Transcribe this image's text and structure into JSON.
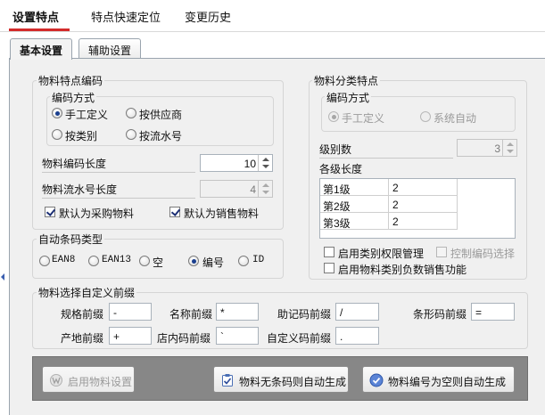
{
  "top_tabs": [
    "设置特点",
    "特点快速定位",
    "变更历史"
  ],
  "sub_tabs": [
    "基本设置",
    "辅助设置"
  ],
  "encode": {
    "title": "物料特点编码",
    "mode_title": "编码方式",
    "options": [
      "手工定义",
      "按供应商",
      "按类别",
      "按流水号"
    ],
    "selected": "手工定义",
    "code_length_label": "物料编码长度",
    "code_length_value": "10",
    "serial_length_label": "物料流水号长度",
    "serial_length_value": "4",
    "default_purchase_label": "默认为采购物料",
    "default_purchase_checked": true,
    "default_sales_label": "默认为销售物料",
    "default_sales_checked": true
  },
  "barcode": {
    "title": "自动条码类型",
    "options": [
      "EAN8",
      "EAN13",
      "空",
      "编号",
      "ID"
    ],
    "selected": "编号"
  },
  "category": {
    "title": "物料分类特点",
    "mode_title": "编码方式",
    "options": [
      "手工定义",
      "系统自动"
    ],
    "selected": "手工定义",
    "levels_label": "级别数",
    "levels_value": "3",
    "level_length_label": "各级长度",
    "level_rows": [
      {
        "name": "第1级",
        "value": "2"
      },
      {
        "name": "第2级",
        "value": "2"
      },
      {
        "name": "第3级",
        "value": "2"
      }
    ],
    "perm_label": "启用类别权限管理",
    "control_label": "控制编码选择",
    "negative_label": "启用物料类别负数销售功能"
  },
  "prefix": {
    "title": "物料选择自定义前缀",
    "fields": [
      {
        "label": "规格前缀",
        "value": "-"
      },
      {
        "label": "名称前缀",
        "value": "*"
      },
      {
        "label": "助记码前缀",
        "value": "/"
      },
      {
        "label": "条形码前缀",
        "value": "="
      },
      {
        "label": "产地前缀",
        "value": "+"
      },
      {
        "label": "店内码前缀",
        "value": "`"
      },
      {
        "label": "自定义码前缀",
        "value": "."
      }
    ]
  },
  "buttons": {
    "enable": "启用物料设置",
    "no_barcode": "物料无条码则自动生成",
    "empty_code": "物料编号为空则自动生成"
  },
  "colors": {
    "active_tab_underline": "#d32b2b",
    "panel_bg": "#f0f0f0",
    "bottom_bar": "#878787",
    "check_mark": "#1c2f75"
  }
}
